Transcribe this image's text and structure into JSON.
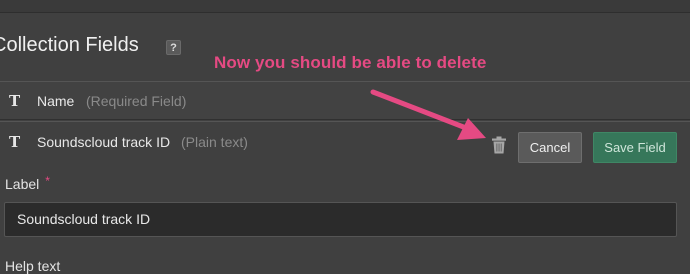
{
  "section": {
    "title": "Collection Fields",
    "help_icon": "?"
  },
  "annotation": "Now you should be able to delete",
  "fields": [
    {
      "icon": "T",
      "name": "Name",
      "hint": "(Required Field)"
    },
    {
      "icon": "T",
      "name": "Soundscloud track ID",
      "hint": "(Plain text)"
    }
  ],
  "editor": {
    "cancel_label": "Cancel",
    "save_label": "Save Field",
    "label_caption": "Label",
    "required_marker": "*",
    "label_value": "Soundscloud track ID",
    "help_text_caption": "Help text"
  },
  "colors": {
    "annotation": "#e54a83",
    "save_button": "#36775a",
    "background": "#404040"
  },
  "icons": [
    "help-icon",
    "text-type-icon",
    "trash-icon",
    "annotation-arrow"
  ]
}
